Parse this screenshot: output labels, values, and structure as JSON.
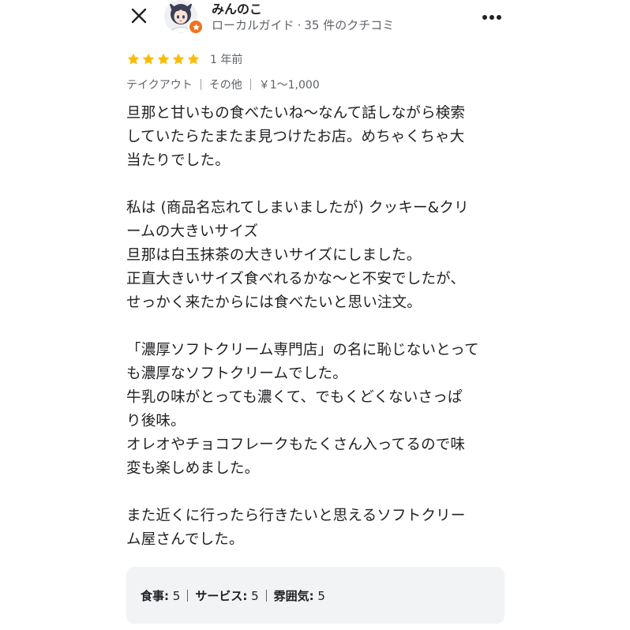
{
  "header": {
    "user_name": "みんのこ",
    "user_role": "ローカルガイド",
    "user_meta_sep": "·",
    "review_count": "35 件のクチコミ"
  },
  "rating": {
    "stars": 5,
    "max_stars": 5,
    "date": "1 年前",
    "star_color": "#fbbc04"
  },
  "tags": [
    "テイクアウト",
    "その他",
    "￥1～1,000"
  ],
  "review": {
    "lines": [
      "旦那と甘いもの食べたいね〜なんて話しながら検索",
      "していたらたまたま見つけたお店。めちゃくちゃ大",
      "当たりでした。",
      "",
      "私は (商品名忘れてしまいましたが) クッキー&クリ",
      "ームの大きいサイズ",
      "旦那は白玉抹茶の大きいサイズにしました。",
      "正直大きいサイズ食べれるかな〜と不安でしたが、",
      "せっかく来たからには食べたいと思い注文。",
      "",
      "「濃厚ソフトクリーム専門店」の名に恥じないとって",
      "も濃厚なソフトクリームでした。",
      "牛乳の味がとっても濃くて、でもくどくないさっぱ",
      "り後味。",
      "オレオやチョコフレークもたくさん入ってるので味",
      "変も楽しめました。",
      "",
      "また近くに行ったら行きたいと思えるソフトクリー",
      "ム屋さんでした。"
    ]
  },
  "aspects": [
    {
      "label": "食事:",
      "value": "5"
    },
    {
      "label": "サービス:",
      "value": "5"
    },
    {
      "label": "雰囲気:",
      "value": "5"
    }
  ],
  "icons": {
    "close": "close-icon",
    "more": "more-vert-icon",
    "badge": "local-guide-star-icon",
    "star": "star-icon"
  },
  "colors": {
    "badge": "#f2711c",
    "text": "#202124",
    "secondary": "#5f6368",
    "aspect_bg": "#f1f3f4"
  }
}
